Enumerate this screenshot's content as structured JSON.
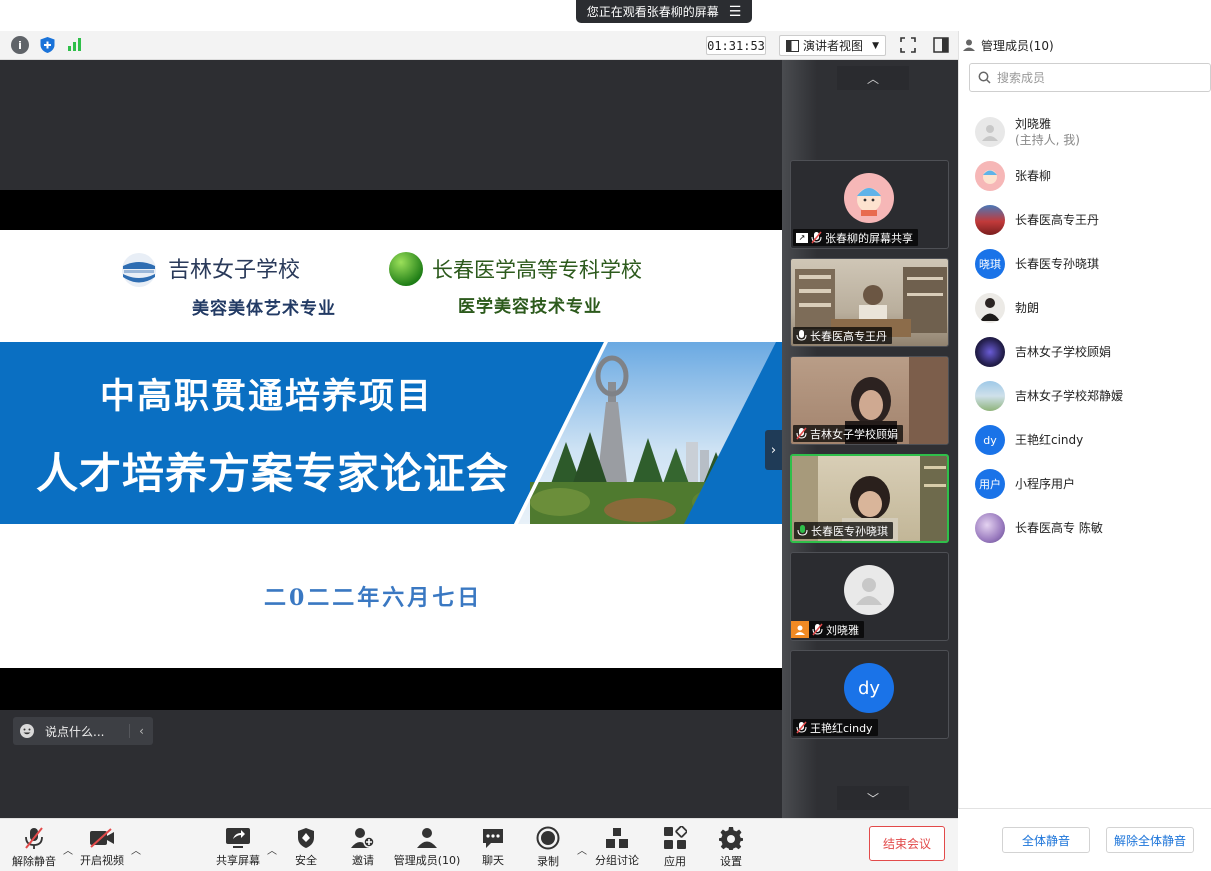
{
  "banner": {
    "viewing_text": "您正在观看张春柳的屏幕"
  },
  "toolbar_top": {
    "timer": "01:31:53",
    "view_mode": "演讲者视图"
  },
  "slide": {
    "school1": "吉林女子学校",
    "school1_major": "美容美体艺术专业",
    "school2": "长春医学高等专科学校",
    "school2_major": "医学美容技术专业",
    "title1": "中高职贯通培养项目",
    "title2": "人才培养方案专家论证会",
    "date": "二0二二年六月七日"
  },
  "chat": {
    "placeholder": "说点什么..."
  },
  "gallery": {
    "tiles": [
      {
        "label": "张春柳的屏幕共享"
      },
      {
        "label": "长春医高专王丹"
      },
      {
        "label": "吉林女子学校顾娟"
      },
      {
        "label": "长春医专孙晓琪"
      },
      {
        "label": "刘晓雅"
      },
      {
        "label": "王艳红cindy",
        "avatar_text": "dy"
      }
    ]
  },
  "panel": {
    "title": "管理成员(10)",
    "search_placeholder": "搜索成员",
    "members": [
      {
        "name": "刘晓雅",
        "sub": "(主持人, 我)"
      },
      {
        "name": "张春柳"
      },
      {
        "name": "长春医高专王丹"
      },
      {
        "name": "长春医专孙晓琪",
        "avatar_text": "晓琪"
      },
      {
        "name": "勃朗"
      },
      {
        "name": "吉林女子学校顾娟"
      },
      {
        "name": "吉林女子学校郑静嫒"
      },
      {
        "name": "王艳红cindy",
        "avatar_text": "dy"
      },
      {
        "name": "小程序用户",
        "avatar_text": "用户"
      },
      {
        "name": "长春医高专 陈敏"
      }
    ],
    "mute_all": "全体静音",
    "unmute_all": "解除全体静音"
  },
  "bottom_bar": {
    "unmute": "解除静音",
    "start_video": "开启视频",
    "share_screen": "共享屏幕",
    "security": "安全",
    "invite": "邀请",
    "manage_members": "管理成员(10)",
    "chat": "聊天",
    "record": "录制",
    "breakout": "分组讨论",
    "apps": "应用",
    "settings": "设置",
    "end_meeting": "结束会议"
  },
  "colors": {
    "accent_blue": "#1a73d9",
    "danger_red": "#e24a4a",
    "slide_blue": "#0a6fc2",
    "active_tile_green": "#2fbf4a",
    "stage_bg": "#2d2e32"
  }
}
